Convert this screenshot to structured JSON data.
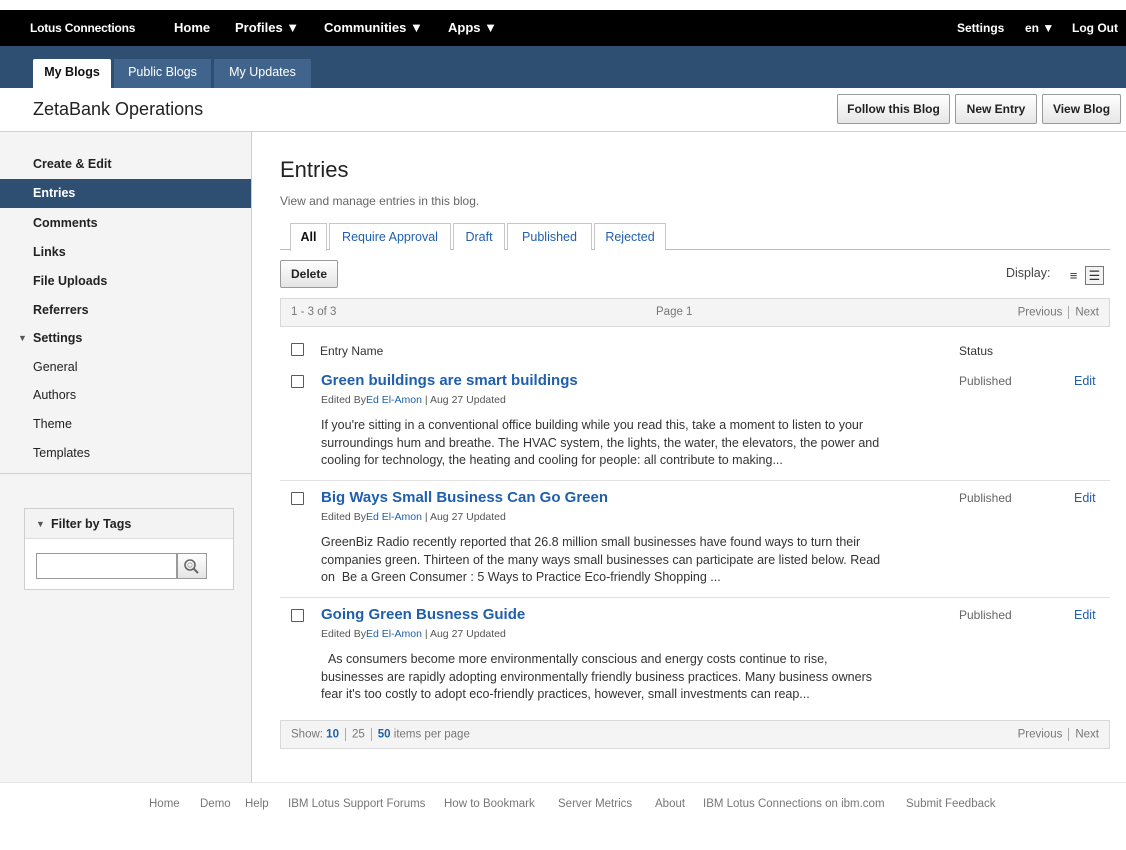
{
  "topnav": {
    "brand": "Lotus Connections",
    "home": "Home",
    "profiles": "Profiles ▼",
    "communities": "Communities ▼",
    "apps": "Apps ▼",
    "settings": "Settings",
    "lang": "en ▼",
    "logout": "Log Out"
  },
  "subtabs": {
    "my_blogs": "My Blogs",
    "public_blogs": "Public Blogs",
    "my_updates": "My Updates"
  },
  "header": {
    "blog_title": "ZetaBank Operations",
    "follow": "Follow this Blog",
    "new_entry": "New Entry",
    "view_blog": "View Blog"
  },
  "sidebar": {
    "items": [
      {
        "label": "Create & Edit"
      },
      {
        "label": "Entries"
      },
      {
        "label": "Comments"
      },
      {
        "label": "Links"
      },
      {
        "label": "File Uploads"
      },
      {
        "label": "Referrers"
      },
      {
        "label": "Settings"
      },
      {
        "label": "General"
      },
      {
        "label": "Authors"
      },
      {
        "label": "Theme"
      },
      {
        "label": "Templates"
      }
    ],
    "filter_title": "Filter by Tags"
  },
  "main": {
    "title": "Entries",
    "description": "View and manage entries in this blog.",
    "tabs": [
      "All",
      "Require Approval",
      "Draft",
      "Published",
      "Rejected"
    ],
    "delete": "Delete",
    "display_label": "Display:",
    "pager": {
      "range": "1 - 3 of 3",
      "page": "Page 1",
      "previous": "Previous",
      "next": "Next"
    },
    "columns": {
      "entry_name": "Entry Name",
      "status": "Status"
    },
    "entries": [
      {
        "title": "Green buildings are smart buildings",
        "edited_by": "Edited By",
        "author": "Ed El-Amon",
        "date_info": " | Aug 27  Updated",
        "body": "If you're sitting in a conventional office building while you read this, take a moment to listen to your\nsurroundings hum and breathe. The HVAC system, the lights, the water, the elevators, the power and\ncooling for technology, the heating and cooling for people: all contribute to making...",
        "status": "Published",
        "edit": "Edit"
      },
      {
        "title": "Big Ways Small Business Can Go Green",
        "edited_by": "Edited By",
        "author": "Ed El-Amon",
        "date_info": " | Aug 27  Updated",
        "body": "GreenBiz Radio recently reported that 26.8 million small businesses have found ways to turn their\ncompanies green. Thirteen of the many ways small businesses can participate are listed below. Read\non  Be a Green Consumer : 5 Ways to Practice Eco-friendly Shopping ...",
        "status": "Published",
        "edit": "Edit"
      },
      {
        "title": "Going Green Busness Guide",
        "edited_by": "Edited By",
        "author": "Ed El-Amon",
        "date_info": " | Aug 27  Updated",
        "body": "  As consumers become more environmentally conscious and energy costs continue to rise,\nbusinesses are rapidly adopting environmentally friendly business practices. Many business owners\nfear it's too costly to adopt eco-friendly practices, however, small investments can reap...",
        "status": "Published",
        "edit": "Edit"
      }
    ],
    "show": {
      "label": "Show:",
      "opt10": "10",
      "opt25": "25",
      "opt50": "50",
      "suffix": "items per page"
    }
  },
  "footer": {
    "links": [
      "Home",
      "Demo",
      "Help",
      "IBM Lotus Support Forums",
      "How to Bookmark",
      "Server Metrics",
      "About",
      "IBM Lotus Connections on ibm.com",
      "Submit Feedback"
    ]
  }
}
